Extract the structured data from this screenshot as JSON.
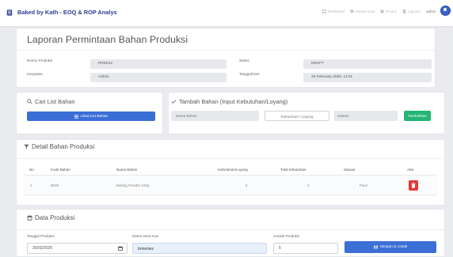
{
  "nav": {
    "brand": "Baked by Kath - EOQ & ROP Analys",
    "links": [
      "Dashboard",
      "Master Data",
      "Proses",
      "Laporan"
    ],
    "user": "admin"
  },
  "header": {
    "title": "Laporan Permintaan Bahan Produksi",
    "nomor_label": "Nomor Produksi",
    "nomor_value": "PRD012",
    "status_label": "Status",
    "status_value": "DRAFT",
    "karyawan_label": "Karyawan",
    "karyawan_value": "Admin",
    "tanggal_label": "Tanggal/Jam",
    "tanggal_value": "25 February 2026, 11:01"
  },
  "cari": {
    "title": "Cari List Bahan",
    "button": "Lihat List Bahan"
  },
  "tambah": {
    "title": "Tambah Bahan (Input Kebutuhan/Loyang)",
    "nama_placeholder": "Nama Bahan",
    "kebutuhan_placeholder": "Kebutuhan / Loyang",
    "satuan_placeholder": "Satuan",
    "button": "Tambahkan"
  },
  "detail": {
    "title": "Detail Bahan Produksi",
    "columns": [
      "No",
      "Kode Bahan",
      "Nama Bahan",
      "Kebutuhan/Loyang",
      "Total Kebutuhan",
      "Satuan",
      "Aksi"
    ],
    "rows": [
      [
        "1",
        "B004",
        "Baking Powder 100g",
        "5",
        "0",
        "Pack"
      ]
    ]
  },
  "produksi": {
    "title": "Data Produksi",
    "tanggal_label": "Tanggal Produksi",
    "tanggal_value": "25/02/2026",
    "nama_label": "Nama Jenis Kue",
    "nama_value": "brownies",
    "jumlah_label": "Jumlah Produksi",
    "jumlah_value": "5",
    "button": "Simpan & Cetak"
  },
  "colors": {
    "brand": "#2c3e94",
    "primary": "#3b6fd6",
    "success": "#22b573",
    "danger": "#e53935"
  }
}
